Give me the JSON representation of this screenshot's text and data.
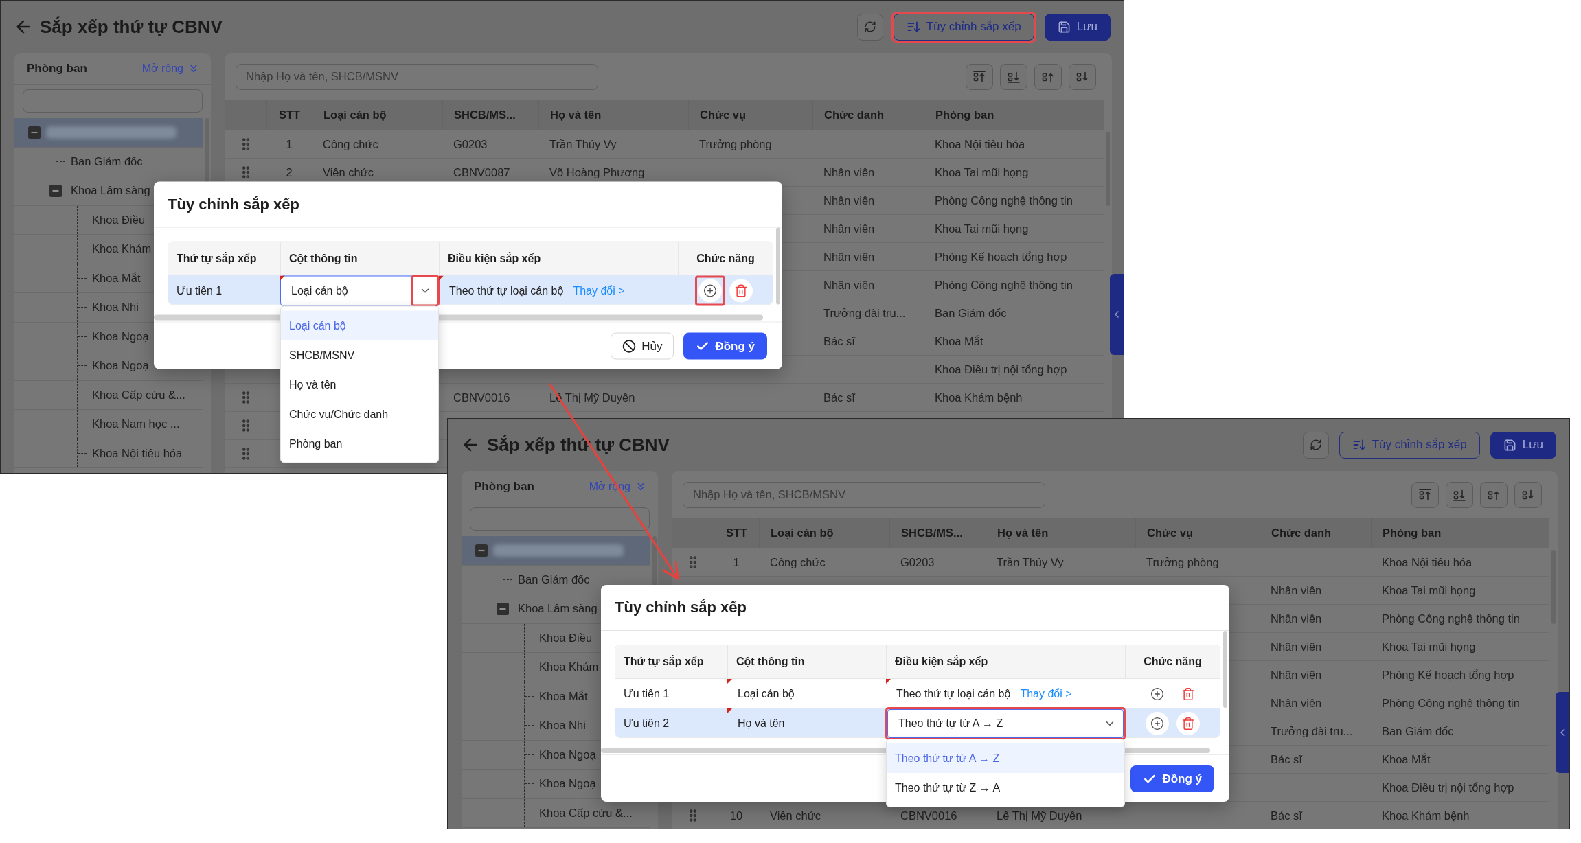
{
  "screens": [
    {
      "title": "Sắp xếp thứ tự CBNV",
      "header_buttons": [
        {
          "kind": "icon",
          "highlighted": false
        },
        {
          "kind": "outline",
          "label": "Tùy chỉnh sắp xếp",
          "highlighted": true
        },
        {
          "kind": "primary",
          "label": "Lưu",
          "highlighted": false
        }
      ],
      "sidebar": {
        "title": "Phòng ban",
        "expand_link": "Mở rộng",
        "tree": [
          {
            "kind": "redacted",
            "selected": true,
            "expanded": true,
            "children": [
              {
                "label": "Ban Giám đốc",
                "selected": false
              },
              {
                "label": "Khoa Lâm sàng",
                "selected": false,
                "expanded": true,
                "children": [
                  {
                    "label": "Khoa Điều",
                    "selected": false
                  },
                  {
                    "label": "Khoa Khám",
                    "selected": false
                  },
                  {
                    "label": "Khoa Mắt",
                    "selected": false
                  },
                  {
                    "label": "Khoa Nhi",
                    "selected": false
                  },
                  {
                    "label": "Khoa Ngoạ",
                    "selected": false
                  },
                  {
                    "label": "Khoa Ngoạ",
                    "selected": false
                  },
                  {
                    "label": "Khoa Cấp cứu &...",
                    "selected": false
                  },
                  {
                    "label": "Khoa Nam học ...",
                    "selected": false
                  },
                  {
                    "label": "Khoa Nội tiêu hóa",
                    "selected": false
                  }
                ]
              }
            ]
          }
        ]
      },
      "search": {
        "placeholder": "Nhập Họ và tên, SHCB/MSNV"
      },
      "table": {
        "columns": [
          "STT",
          "Loại cán bộ",
          "SHCB/MS...",
          "Họ và tên",
          "Chức vụ",
          "Chức danh",
          "Phòng ban"
        ],
        "rows": [
          {
            "drag_handle": true,
            "stt": "1",
            "staff_type": "Công chức",
            "code": "G0203",
            "full_name": "Trần Thúy Vy",
            "position": "Trưởng phòng",
            "department": "Khoa Nội tiêu hóa"
          },
          {
            "drag_handle": true,
            "stt": "2",
            "staff_type": "Viên chức",
            "code": "CBNV0087",
            "full_name": "Võ Hoàng Phương",
            "job_title": "Nhân viên",
            "department": "Khoa Tai mũi họng"
          },
          {
            "drag_handle": false,
            "job_title": "Nhân viên",
            "department": "Phòng Công nghệ thông tin"
          },
          {
            "drag_handle": false,
            "job_title": "Nhân viên",
            "department": "Khoa Tai mũi họng"
          },
          {
            "drag_handle": false,
            "job_title": "Nhân viên",
            "department": "Phòng Kế hoạch tổng hợp"
          },
          {
            "drag_handle": false,
            "job_title": "Nhân viên",
            "department": "Phòng Công nghệ thông tin"
          },
          {
            "drag_handle": false,
            "job_title": "Trưởng đài tru...",
            "department": "Ban Giám đốc"
          },
          {
            "drag_handle": false,
            "job_title": "Bác sĩ",
            "department": "Khoa Mắt"
          },
          {
            "drag_handle": false,
            "department": "Khoa Điều trị nội tổng hợp"
          },
          {
            "drag_handle": true,
            "code": "CBNV0016",
            "full_name": "Lê Thị Mỹ Duyên",
            "job_title": "Bác sĩ",
            "department": "Khoa Khám bệnh"
          },
          {
            "drag_handle": true
          },
          {
            "drag_handle": true
          }
        ]
      },
      "dialog": {
        "title": "Tùy chỉnh sắp xếp",
        "columns": [
          "Thứ tự sắp xếp",
          "Cột thông tin",
          "Điều kiện sắp xếp",
          "Chức năng"
        ],
        "rows": [
          {
            "priority": "Ưu tiên 1",
            "selected": true,
            "column": {
              "kind": "select",
              "value": "Loại cán bộ",
              "open": true,
              "highlighted": false,
              "arrow_highlighted": true,
              "edited": true,
              "options": [
                {
                  "label": "Loại cán bộ",
                  "selected": true
                },
                {
                  "label": "SHCB/MSNV",
                  "selected": false
                },
                {
                  "label": "Họ và tên",
                  "selected": false
                },
                {
                  "label": "Chức vụ/Chức danh",
                  "selected": false
                },
                {
                  "label": "Phòng ban",
                  "selected": false
                }
              ]
            },
            "condition": {
              "kind": "text",
              "value": "Theo thứ tự loại cán bộ",
              "link": "Thay đổi >",
              "edited": true
            },
            "actions": [
              {
                "kind": "add",
                "highlighted": true
              },
              {
                "kind": "delete",
                "highlighted": false
              }
            ]
          }
        ],
        "buttons": [
          {
            "kind": "cancel",
            "label": "Hủy"
          },
          {
            "kind": "confirm",
            "label": "Đồng ý"
          }
        ]
      }
    },
    {
      "title": "Sắp xếp thứ tự CBNV",
      "header_buttons": [
        {
          "kind": "icon",
          "highlighted": false
        },
        {
          "kind": "outline",
          "label": "Tùy chỉnh sắp xếp",
          "highlighted": false
        },
        {
          "kind": "primary",
          "label": "Lưu",
          "highlighted": false
        }
      ],
      "sidebar": {
        "title": "Phòng ban",
        "expand_link": "Mở rộng",
        "tree": [
          {
            "kind": "redacted",
            "selected": true,
            "expanded": true,
            "children": [
              {
                "label": "Ban Giám đốc",
                "selected": false
              },
              {
                "label": "Khoa Lâm sàng",
                "selected": false,
                "expanded": true,
                "children": [
                  {
                    "label": "Khoa Điều",
                    "selected": false
                  },
                  {
                    "label": "Khoa Khám",
                    "selected": false
                  },
                  {
                    "label": "Khoa Mắt",
                    "selected": false
                  },
                  {
                    "label": "Khoa Nhi",
                    "selected": false
                  },
                  {
                    "label": "Khoa Ngoạ",
                    "selected": false
                  },
                  {
                    "label": "Khoa Ngoạ",
                    "selected": false
                  },
                  {
                    "label": "Khoa Cấp cứu &...",
                    "selected": false
                  }
                ]
              }
            ]
          }
        ]
      },
      "search": {
        "placeholder": "Nhập Họ và tên, SHCB/MSNV"
      },
      "table": {
        "columns": [
          "STT",
          "Loại cán bộ",
          "SHCB/MS...",
          "Họ và tên",
          "Chức vụ",
          "Chức danh",
          "Phòng ban"
        ],
        "rows": [
          {
            "drag_handle": true,
            "stt": "1",
            "staff_type": "Công chức",
            "code": "G0203",
            "full_name": "Trần Thúy Vy",
            "position": "Trưởng phòng",
            "department": "Khoa Nội tiêu hóa"
          },
          {
            "drag_handle": false,
            "job_title": "Nhân viên",
            "department": "Khoa Tai mũi họng"
          },
          {
            "drag_handle": false,
            "job_title": "Nhân viên",
            "department": "Phòng Công nghệ thông tin"
          },
          {
            "drag_handle": false,
            "job_title": "Nhân viên",
            "department": "Khoa Tai mũi họng"
          },
          {
            "drag_handle": false,
            "job_title": "Nhân viên",
            "department": "Phòng Kế hoạch tổng hợp"
          },
          {
            "drag_handle": false,
            "job_title": "Nhân viên",
            "department": "Phòng Công nghệ thông tin"
          },
          {
            "drag_handle": false,
            "job_title": "Trưởng đài tru...",
            "department": "Ban Giám đốc"
          },
          {
            "drag_handle": false,
            "job_title": "Bác sĩ",
            "department": "Khoa Mắt"
          },
          {
            "drag_handle": false,
            "department": "Khoa Điều trị nội tổng hợp"
          },
          {
            "drag_handle": true,
            "stt": "10",
            "staff_type": "Viên chức",
            "code": "CBNV0016",
            "full_name": "Lê Thị Mỹ Duyên",
            "job_title": "Bác sĩ",
            "department": "Khoa Khám bệnh"
          }
        ]
      },
      "dialog": {
        "title": "Tùy chỉnh sắp xếp",
        "columns": [
          "Thứ tự sắp xếp",
          "Cột thông tin",
          "Điều kiện sắp xếp",
          "Chức năng"
        ],
        "rows": [
          {
            "priority": "Ưu tiên 1",
            "selected": false,
            "column": {
              "kind": "text",
              "value": "Loại cán bộ",
              "edited": true
            },
            "condition": {
              "kind": "text",
              "value": "Theo thứ tự loại cán bộ",
              "link": "Thay đổi >",
              "edited": true
            },
            "actions": [
              {
                "kind": "add",
                "highlighted": false
              },
              {
                "kind": "delete",
                "highlighted": false
              }
            ]
          },
          {
            "priority": "Ưu tiên 2",
            "selected": true,
            "column": {
              "kind": "text",
              "value": "Họ và tên",
              "edited": true
            },
            "condition": {
              "kind": "select",
              "value": "Theo thứ tự từ A → Z",
              "open": true,
              "highlighted": true,
              "arrow_highlighted": false,
              "edited": false,
              "options": [
                {
                  "label": "Theo thứ tự từ A → Z",
                  "selected": true
                },
                {
                  "label": "Theo thứ tự từ Z → A",
                  "selected": false
                }
              ]
            },
            "actions": [
              {
                "kind": "add",
                "highlighted": false
              },
              {
                "kind": "delete",
                "highlighted": false
              }
            ]
          }
        ],
        "buttons": [
          {
            "kind": "confirm",
            "label": "Đồng ý"
          }
        ]
      }
    }
  ]
}
